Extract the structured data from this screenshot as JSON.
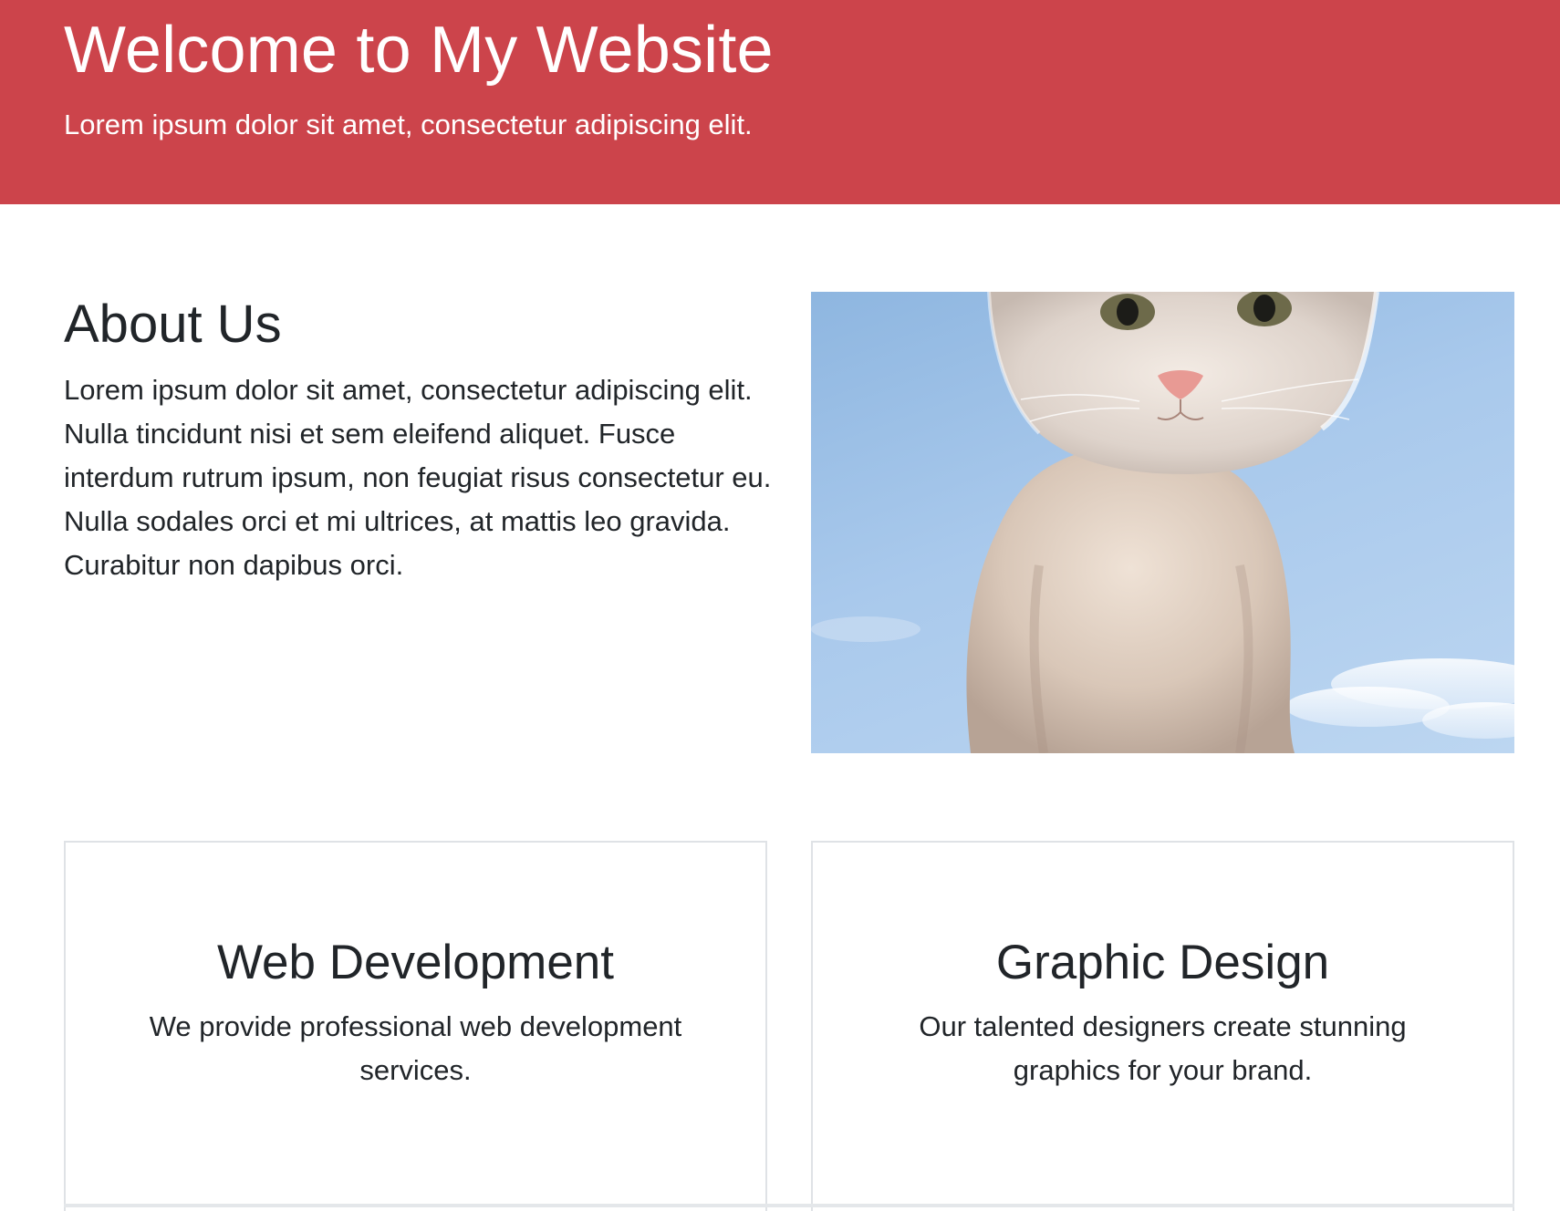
{
  "header": {
    "title": "Welcome to My Website",
    "subtitle": "Lorem ipsum dolor sit amet, consectetur adipiscing elit."
  },
  "about": {
    "title": "About Us",
    "text": "Lorem ipsum dolor sit amet, consectetur adipiscing elit. Nulla tincidunt nisi et sem eleifend aliquet. Fusce interdum rutrum ipsum, non feugiat risus consectetur eu. Nulla sodales orci et mi ultrices, at mattis leo gravida. Curabitur non dapibus orci."
  },
  "services": [
    {
      "title": "Web Development",
      "text": "We provide professional web development services."
    },
    {
      "title": "Graphic Design",
      "text": "Our talented designers create stunning graphics for your brand."
    }
  ],
  "colors": {
    "header_background": "#cc444b",
    "header_text": "#ffffff",
    "body_text": "#212529",
    "card_border": "#dfe2e6"
  }
}
